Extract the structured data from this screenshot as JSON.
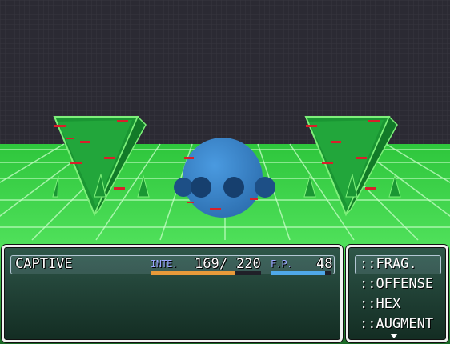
{
  "scene": {
    "sky_color": "#2b2a33",
    "floor_color": "#3fd64a",
    "grid_color": "#b6ffb6",
    "enemies": [
      {
        "name": "left-pyramid",
        "color": "#1f9e34"
      },
      {
        "name": "center-orb",
        "color": "#3a86c8"
      },
      {
        "name": "right-pyramid",
        "color": "#1f9e34"
      }
    ]
  },
  "status": {
    "actor_name": "CAPTIVE",
    "hp_label": "INTE.",
    "hp_value": "169",
    "hp_max": "220",
    "hp_separator": "/",
    "hp_ratio": 0.768,
    "hp_color": "#e89a3a",
    "fp_label": "F.P.",
    "fp_value": "48",
    "fp_ratio": 0.9,
    "fp_color": "#4fa8e8"
  },
  "commands": [
    {
      "label": "::FRAG.",
      "selected": true
    },
    {
      "label": "::OFFENSE",
      "selected": false
    },
    {
      "label": "::HEX",
      "selected": false
    },
    {
      "label": "::AUGMENT",
      "selected": false
    }
  ],
  "more_indicator": "down-arrow-icon"
}
